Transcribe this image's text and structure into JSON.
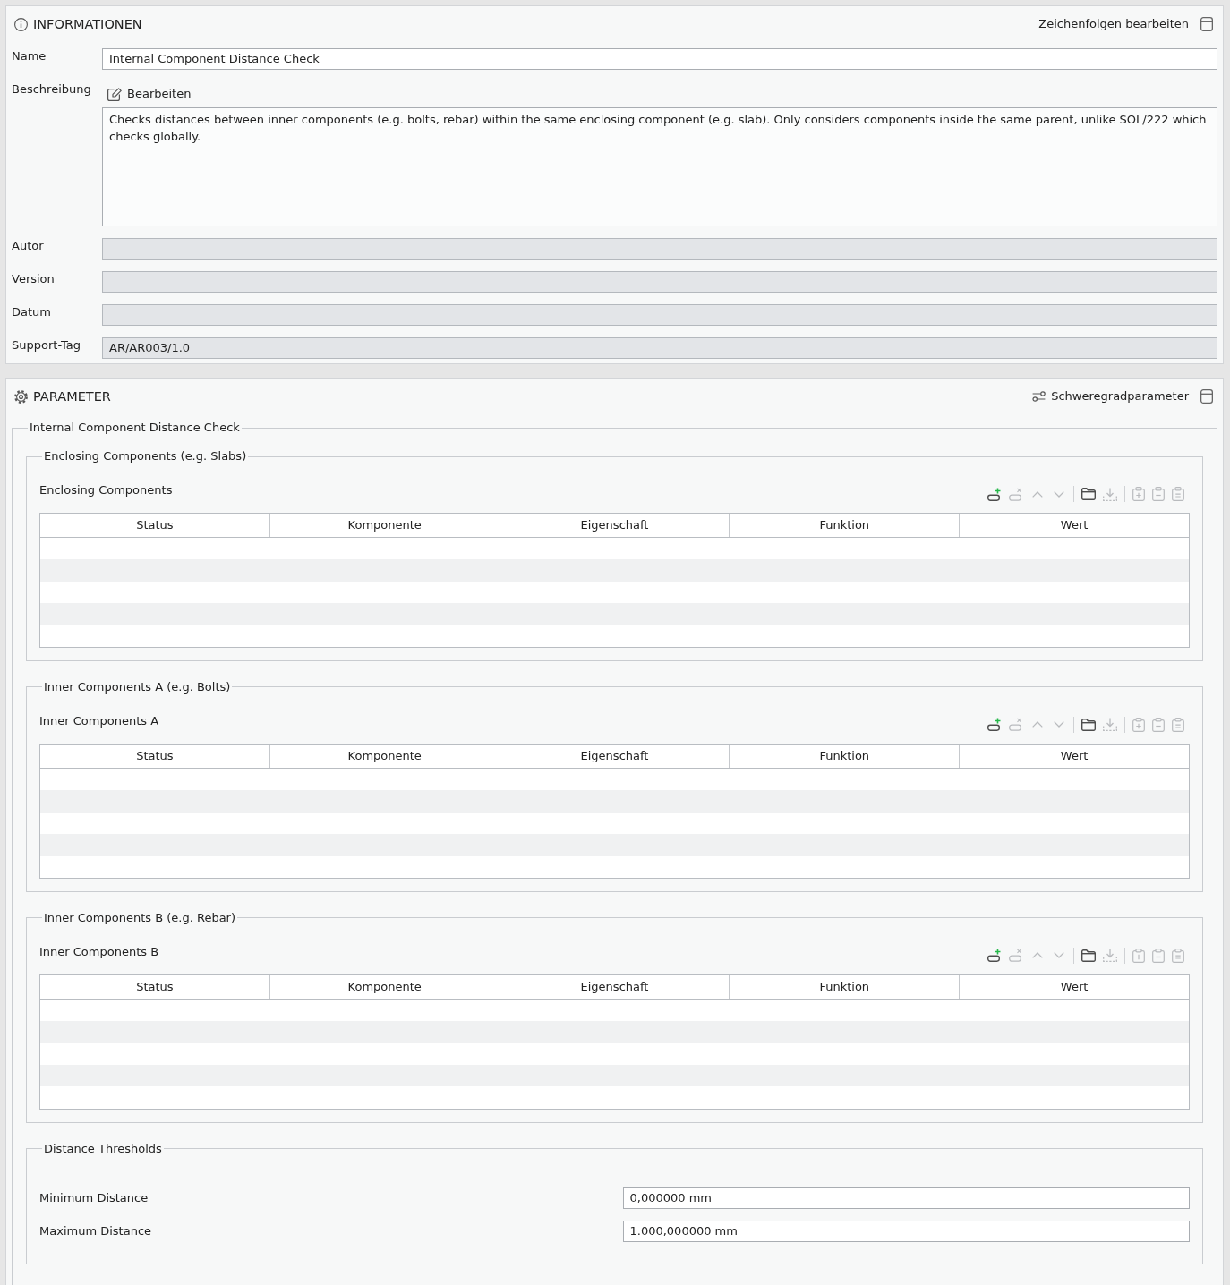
{
  "info_panel": {
    "title": "INFORMATIONEN",
    "action": "Zeichenfolgen bearbeiten",
    "fields": [
      {
        "kind": "text",
        "label": "Name",
        "value": "Internal Component Distance Check",
        "disabled": false
      },
      {
        "kind": "textarea",
        "label": "Beschreibung",
        "edit": "Bearbeiten",
        "value": "Checks distances between inner components (e.g. bolts, rebar) within the same enclosing component (e.g. slab). Only considers components inside the same parent, unlike SOL/222 which checks globally."
      },
      {
        "kind": "text",
        "label": "Autor",
        "disabled": true
      },
      {
        "kind": "text",
        "label": "Version",
        "disabled": true
      },
      {
        "kind": "text",
        "label": "Datum",
        "disabled": true
      },
      {
        "kind": "text",
        "label": "Support-Tag",
        "value": "AR/AR003/1.0",
        "disabled": true
      }
    ]
  },
  "parameter_panel": {
    "title": "PARAMETER",
    "action": "Schweregradparameter",
    "group": {
      "legend": "Internal Component Distance Check",
      "sections": [
        {
          "kind": "table",
          "legend": "Enclosing Components (e.g. Slabs)",
          "table_title": "Enclosing Components",
          "toolbar": [
            {
              "tools": [
                {
                  "kind": "add-row",
                  "disabled": false
                },
                {
                  "kind": "remove-row",
                  "disabled": true
                },
                {
                  "kind": "move-up",
                  "disabled": true
                },
                {
                  "kind": "move-down",
                  "disabled": true
                }
              ]
            },
            {
              "tools": [
                {
                  "kind": "open",
                  "disabled": false
                },
                {
                  "kind": "import",
                  "disabled": true
                }
              ]
            },
            {
              "tools": [
                {
                  "kind": "paste-add",
                  "disabled": true
                },
                {
                  "kind": "paste-remove",
                  "disabled": true
                },
                {
                  "kind": "paste-replace",
                  "disabled": true
                }
              ]
            }
          ],
          "columns": [
            "Status",
            "Komponente",
            "Eigenschaft",
            "Funktion",
            "Wert"
          ]
        },
        {
          "kind": "table",
          "legend": "Inner Components A (e.g. Bolts)",
          "table_title": "Inner Components A",
          "toolbar": [
            {
              "tools": [
                {
                  "kind": "add-row",
                  "disabled": false
                },
                {
                  "kind": "remove-row",
                  "disabled": true
                },
                {
                  "kind": "move-up",
                  "disabled": true
                },
                {
                  "kind": "move-down",
                  "disabled": true
                }
              ]
            },
            {
              "tools": [
                {
                  "kind": "open",
                  "disabled": false
                },
                {
                  "kind": "import",
                  "disabled": true
                }
              ]
            },
            {
              "tools": [
                {
                  "kind": "paste-add",
                  "disabled": true
                },
                {
                  "kind": "paste-remove",
                  "disabled": true
                },
                {
                  "kind": "paste-replace",
                  "disabled": true
                }
              ]
            }
          ],
          "columns": [
            "Status",
            "Komponente",
            "Eigenschaft",
            "Funktion",
            "Wert"
          ]
        },
        {
          "kind": "table",
          "legend": "Inner Components B (e.g. Rebar)",
          "table_title": "Inner Components B",
          "toolbar": [
            {
              "tools": [
                {
                  "kind": "add-row",
                  "disabled": false
                },
                {
                  "kind": "remove-row",
                  "disabled": true
                },
                {
                  "kind": "move-up",
                  "disabled": true
                },
                {
                  "kind": "move-down",
                  "disabled": true
                }
              ]
            },
            {
              "tools": [
                {
                  "kind": "open",
                  "disabled": false
                },
                {
                  "kind": "import",
                  "disabled": true
                }
              ]
            },
            {
              "tools": [
                {
                  "kind": "paste-add",
                  "disabled": true
                },
                {
                  "kind": "paste-remove",
                  "disabled": true
                },
                {
                  "kind": "paste-replace",
                  "disabled": true
                }
              ]
            }
          ],
          "columns": [
            "Status",
            "Komponente",
            "Eigenschaft",
            "Funktion",
            "Wert"
          ]
        },
        {
          "kind": "fields",
          "legend": "Distance Thresholds",
          "fields": [
            {
              "label": "Minimum Distance",
              "value": "0,000000 mm"
            },
            {
              "label": "Maximum Distance",
              "value": "1.000,000000 mm"
            }
          ]
        }
      ]
    }
  }
}
